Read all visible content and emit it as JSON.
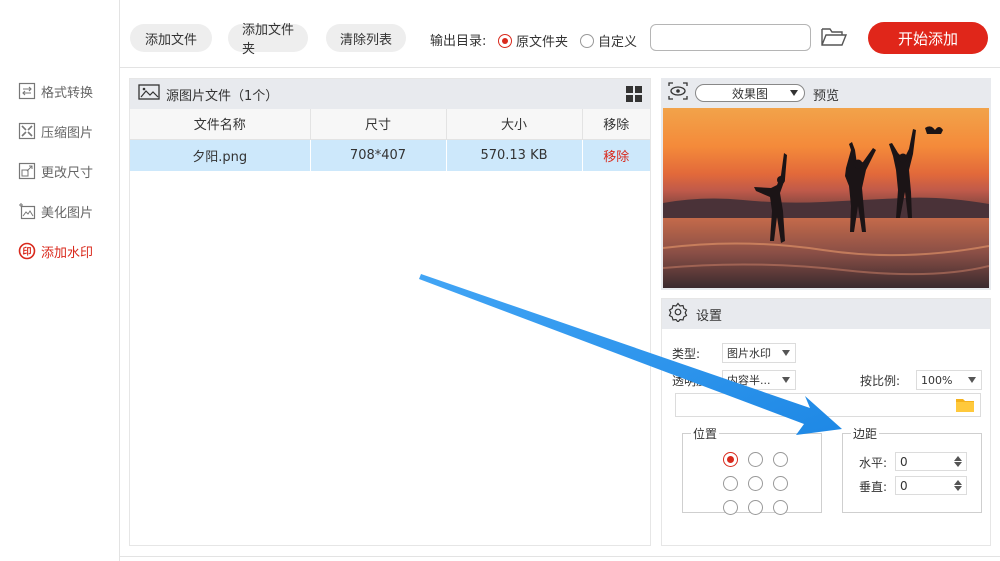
{
  "sidebar": {
    "items": [
      {
        "label": "格式转换",
        "icon": "convert-icon"
      },
      {
        "label": "压缩图片",
        "icon": "compress-icon"
      },
      {
        "label": "更改尺寸",
        "icon": "resize-icon"
      },
      {
        "label": "美化图片",
        "icon": "beautify-icon"
      },
      {
        "label": "添加水印",
        "icon": "watermark-icon",
        "active": true
      }
    ]
  },
  "toolbar": {
    "add_file": "添加文件",
    "add_folder": "添加文件夹",
    "clear_list": "清除列表",
    "output_label": "输出目录:",
    "radio_original": "原文件夹",
    "radio_custom": "自定义",
    "output_path": "",
    "start_button": "开始添加"
  },
  "files": {
    "title": "源图片文件（1个）",
    "columns": [
      "文件名称",
      "尺寸",
      "大小",
      "移除"
    ],
    "rows": [
      {
        "name": "夕阳.png",
        "size_dim": "708*407",
        "filesize": "570.13 KB",
        "remove": "移除"
      }
    ]
  },
  "preview": {
    "mode": "效果图",
    "label": "预览"
  },
  "settings": {
    "title": "设置",
    "type_label": "类型:",
    "type_value": "图片水印",
    "opacity_label": "透明度:",
    "opacity_value": "内容半...",
    "scale_label": "按比例:",
    "scale_value": "100%",
    "position_legend": "位置",
    "position_selected": "top-left",
    "margin_legend": "边距",
    "horizontal_label": "水平:",
    "horizontal_value": "0",
    "vertical_label": "垂直:",
    "vertical_value": "0"
  },
  "colors": {
    "accent": "#e0261a",
    "selected_row": "#cde8fb",
    "annotation_arrow": "#2196f3"
  }
}
